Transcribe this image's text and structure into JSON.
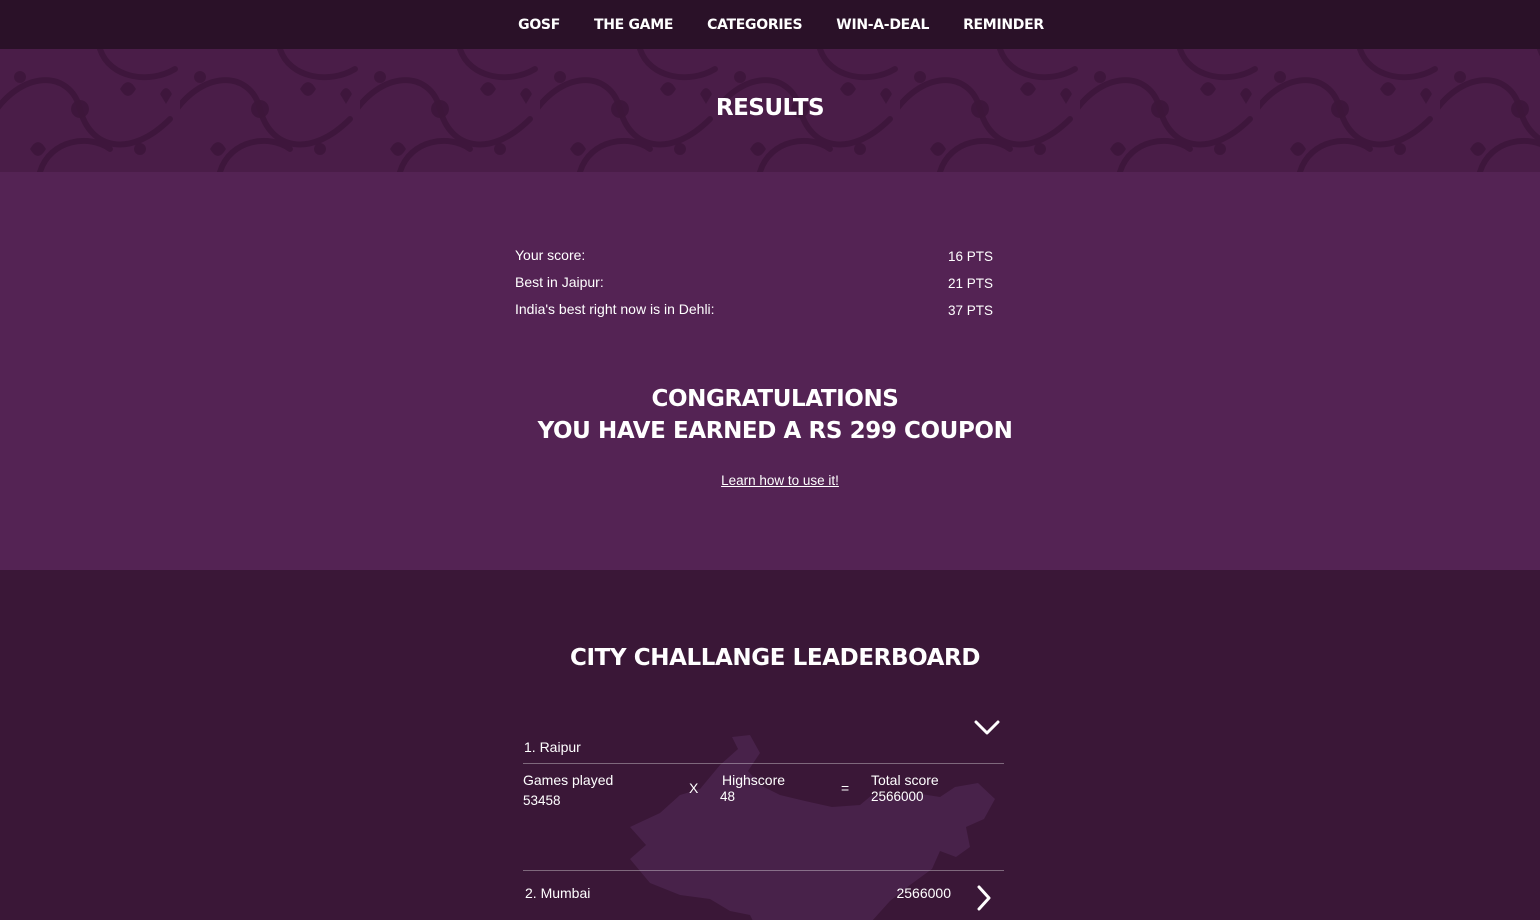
{
  "nav": {
    "items": [
      {
        "label": "GOSF"
      },
      {
        "label": "THE GAME"
      },
      {
        "label": "CATEGORIES"
      },
      {
        "label": "WIN-A-DEAL"
      },
      {
        "label": "REMINDER"
      }
    ]
  },
  "banner": {
    "title": "RESULTS"
  },
  "results": {
    "rows": [
      {
        "label": "Your score:",
        "value": "16 PTS"
      },
      {
        "label": "Best in Jaipur:",
        "value": "21 PTS"
      },
      {
        "label": "India's best right now is in Dehli:",
        "value": "37 PTS"
      }
    ],
    "congrats_line1": "CONGRATULATIONS",
    "congrats_line2": "YOU HAVE EARNED A RS 299 COUPON",
    "learn_link": "Learn how to use it!"
  },
  "leaderboard": {
    "title": "CITY CHALLANGE LEADERBOARD",
    "cities": [
      {
        "name": "1.  Raipur",
        "expanded": true,
        "games_played_label": "Games played",
        "games_played": "53458",
        "multiply_symbol": "X",
        "highscore_label": "Highscore",
        "highscore": "48",
        "equals_symbol": "=",
        "total_score_label": "Total score",
        "total_score": "2566000"
      },
      {
        "name": "2. Mumbai",
        "expanded": false,
        "total_score": "2566000"
      }
    ]
  },
  "icons": {
    "expanded_chevron": "chevron-down-icon",
    "collapsed_chevron": "chevron-right-icon"
  },
  "colors": {
    "nav_bg": "#2a1128",
    "banner_bg": "#4a1d48",
    "results_bg": "#542354",
    "leaderboard_bg": "#3a1737",
    "text": "#ffffff"
  }
}
